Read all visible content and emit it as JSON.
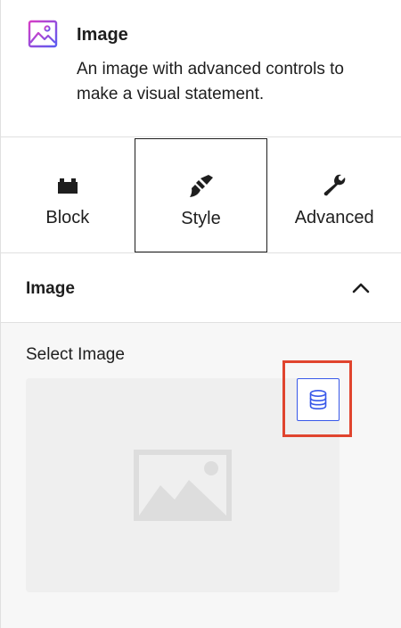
{
  "block_card": {
    "title": "Image",
    "description": "An image with advanced controls to make a visual statement.",
    "icon": "image-icon",
    "icon_gradient_start": "#d63dc6",
    "icon_gradient_end": "#5b5bf0"
  },
  "tabs": [
    {
      "label": "Block",
      "icon": "block-icon",
      "active": false
    },
    {
      "label": "Style",
      "icon": "brush-icon",
      "active": true
    },
    {
      "label": "Advanced",
      "icon": "wrench-icon",
      "active": false
    }
  ],
  "section": {
    "title": "Image",
    "expanded": true,
    "select_label": "Select Image",
    "media_button_icon": "database-icon",
    "accent_color": "#3858e9",
    "highlight_color": "#e0442e"
  }
}
